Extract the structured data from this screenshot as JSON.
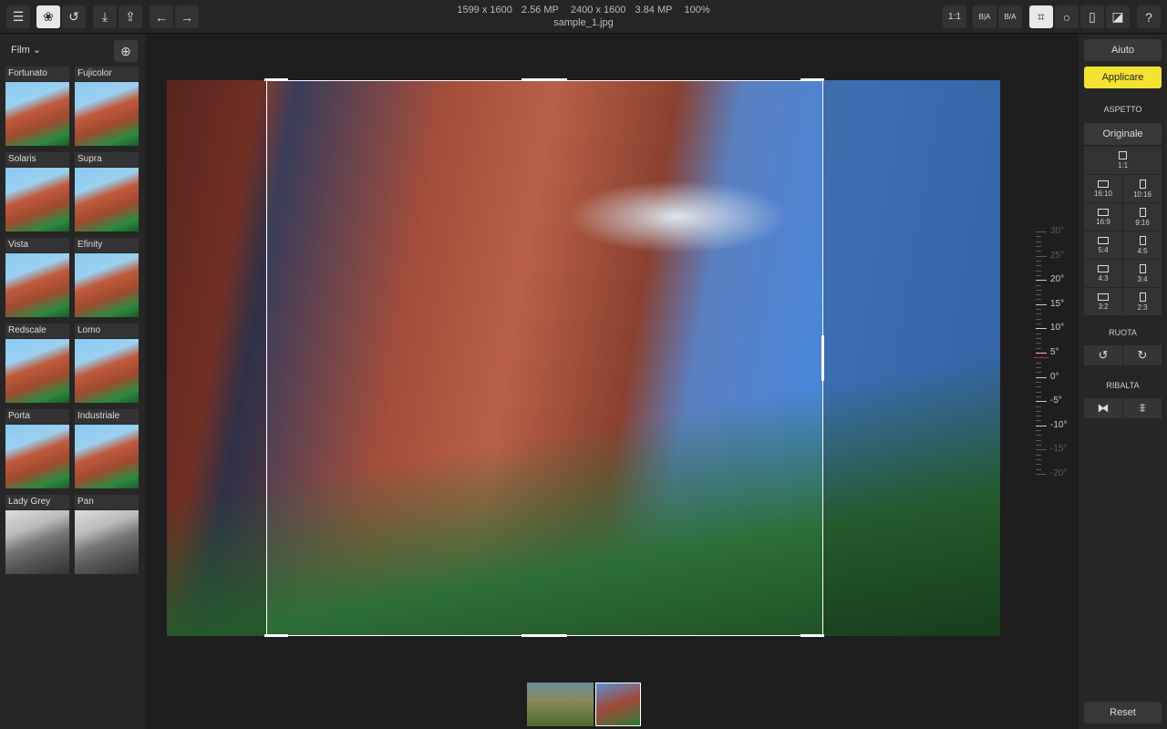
{
  "toolbar": {
    "left_icons": [
      "menu-icon",
      "filters-icon",
      "history-icon",
      "import-icon",
      "export-icon",
      "undo-icon",
      "redo-icon"
    ],
    "right": {
      "zoom_1to1": "1:1",
      "compare_ba": "B|A",
      "split_ba": "B/A",
      "help": "?"
    }
  },
  "info": {
    "orig_dims": "1599 x 1600",
    "orig_mp": "2.56 MP",
    "full_dims": "2400 x 1600",
    "full_mp": "3.84 MP",
    "zoom": "100%",
    "filename": "sample_1.jpg"
  },
  "left": {
    "category": "Film ⌄",
    "filters": [
      "Fortunato",
      "Fujicolor",
      "Solaris",
      "Supra",
      "Vista",
      "Efinity",
      "Redscale",
      "Lomo",
      "Porta",
      "Industriale",
      "Lady Grey",
      "Pan"
    ]
  },
  "right": {
    "help": "Aiuto",
    "apply": "Applicare",
    "aspect_title": "ASPETTO",
    "original": "Originale",
    "square": "1:1",
    "ratios": [
      "16:10",
      "10:16",
      "16:9",
      "9:16",
      "5:4",
      "4:5",
      "4:3",
      "3:4",
      "3:2",
      "2:3"
    ],
    "rotate_title": "RUOTA",
    "flip_title": "RIBALTA",
    "reset": "Reset"
  },
  "ruler": {
    "labels": [
      "30°",
      "25°",
      "20°",
      "15°",
      "10°",
      "5°",
      "0°",
      "-5°",
      "-10°",
      "-15°",
      "-20°"
    ],
    "current_angle_deg": 4
  },
  "accent": "#f4e332"
}
